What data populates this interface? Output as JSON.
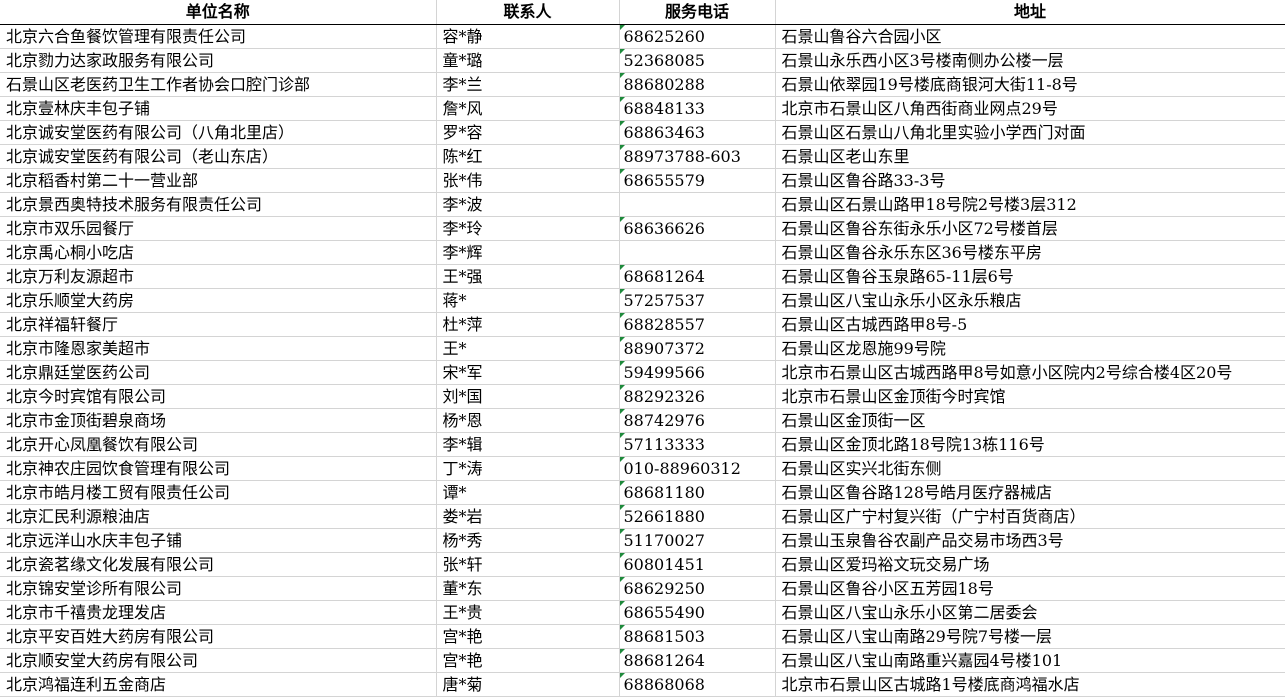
{
  "sheet": {
    "headers": [
      "单位名称",
      "联系人",
      "服务电话",
      "地址"
    ],
    "rows": [
      {
        "name": "北京六合鱼餐饮管理有限责任公司",
        "contact": "容*静",
        "phone": "68625260",
        "address": "石景山鲁谷六合园小区"
      },
      {
        "name": "北京勠力达家政服务有限公司",
        "contact": "童*璐",
        "phone": "52368085",
        "address": "石景山永乐西小区3号楼南侧办公楼一层"
      },
      {
        "name": "石景山区老医药卫生工作者协会口腔门诊部",
        "contact": "李*兰",
        "phone": "88680288",
        "address": "石景山依翠园19号楼底商银河大街11-8号"
      },
      {
        "name": "北京壹林庆丰包子铺",
        "contact": "詹*风",
        "phone": "68848133",
        "address": "北京市石景山区八角西街商业网点29号"
      },
      {
        "name": "北京诚安堂医药有限公司（八角北里店）",
        "contact": "罗*容",
        "phone": "68863463",
        "address": "石景山区石景山八角北里实验小学西门对面"
      },
      {
        "name": "北京诚安堂医药有限公司（老山东店）",
        "contact": "陈*红",
        "phone": "88973788-603",
        "address": "石景山区老山东里"
      },
      {
        "name": "北京稻香村第二十一营业部",
        "contact": "张*伟",
        "phone": "68655579",
        "address": "石景山区鲁谷路33-3号"
      },
      {
        "name": "北京景西奥特技术服务有限责任公司",
        "contact": "李*波",
        "phone": "",
        "address": "石景山区石景山路甲18号院2号楼3层312"
      },
      {
        "name": "北京市双乐园餐厅",
        "contact": "李*玲",
        "phone": "68636626",
        "address": "石景山区鲁谷东街永乐小区72号楼首层"
      },
      {
        "name": "北京禹心桐小吃店",
        "contact": "李*辉",
        "phone": "",
        "address": "石景山区鲁谷永乐东区36号楼东平房"
      },
      {
        "name": "北京万利友源超市",
        "contact": "王*强",
        "phone": "68681264",
        "address": "石景山区鲁谷玉泉路65-11层6号"
      },
      {
        "name": "北京乐顺堂大药房",
        "contact": "蒋*",
        "phone": "57257537",
        "address": "石景山区八宝山永乐小区永乐粮店"
      },
      {
        "name": "北京祥福轩餐厅",
        "contact": "杜*萍",
        "phone": "68828557",
        "address": "石景山区古城西路甲8号-5"
      },
      {
        "name": "北京市隆恩家美超市",
        "contact": "王*",
        "phone": "88907372",
        "address": "石景山区龙恩施99号院"
      },
      {
        "name": "北京鼎廷堂医药公司",
        "contact": "宋*军",
        "phone": "59499566",
        "address": "北京市石景山区古城西路甲8号如意小区院内2号综合楼4区20号"
      },
      {
        "name": "北京今时宾馆有限公司",
        "contact": "刘*国",
        "phone": "88292326",
        "address": "北京市石景山区金顶街今时宾馆"
      },
      {
        "name": "北京市金顶街碧泉商场",
        "contact": "杨*恩",
        "phone": "88742976",
        "address": "石景山区金顶街一区"
      },
      {
        "name": "北京开心凤凰餐饮有限公司",
        "contact": "李*辑",
        "phone": "57113333",
        "address": "石景山区金顶北路18号院13栋116号"
      },
      {
        "name": "北京神农庄园饮食管理有限公司",
        "contact": "丁*涛",
        "phone": "010-88960312",
        "address": "石景山区实兴北街东侧"
      },
      {
        "name": "北京市皓月楼工贸有限责任公司",
        "contact": "谭*",
        "phone": "68681180",
        "address": "石景山区鲁谷路128号皓月医疗器械店"
      },
      {
        "name": "北京汇民利源粮油店",
        "contact": "娄*岩",
        "phone": "52661880",
        "address": "石景山区广宁村复兴街（广宁村百货商店）"
      },
      {
        "name": "北京远洋山水庆丰包子铺",
        "contact": "杨*秀",
        "phone": "51170027",
        "address": "石景山玉泉鲁谷农副产品交易市场西3号"
      },
      {
        "name": "北京瓷茗缘文化发展有限公司",
        "contact": "张*轩",
        "phone": "60801451",
        "address": "石景山区爱玛裕文玩交易广场"
      },
      {
        "name": "北京锦安堂诊所有限公司",
        "contact": "董*东",
        "phone": "68629250",
        "address": "石景山区鲁谷小区五芳园18号"
      },
      {
        "name": "北京市千禧贵龙理发店",
        "contact": "王*贵",
        "phone": "68655490",
        "address": "石景山区八宝山永乐小区第二居委会"
      },
      {
        "name": "北京平安百姓大药房有限公司",
        "contact": "宫*艳",
        "phone": "88681503",
        "address": "石景山区八宝山南路29号院7号楼一层"
      },
      {
        "name": "北京顺安堂大药房有限公司",
        "contact": "宫*艳",
        "phone": "88681264",
        "address": "石景山区八宝山南路重兴嘉园4号楼101"
      },
      {
        "name": "北京鸿福连利五金商店",
        "contact": "唐*菊",
        "phone": "68868068",
        "address": "北京市石景山区古城路1号楼底商鸿福水店"
      }
    ]
  },
  "colors": {
    "grid": "#d4d4d4",
    "text_flag": "#1e8a3c"
  },
  "icons": {
    "number_as_text_marker": "green-corner-triangle"
  }
}
